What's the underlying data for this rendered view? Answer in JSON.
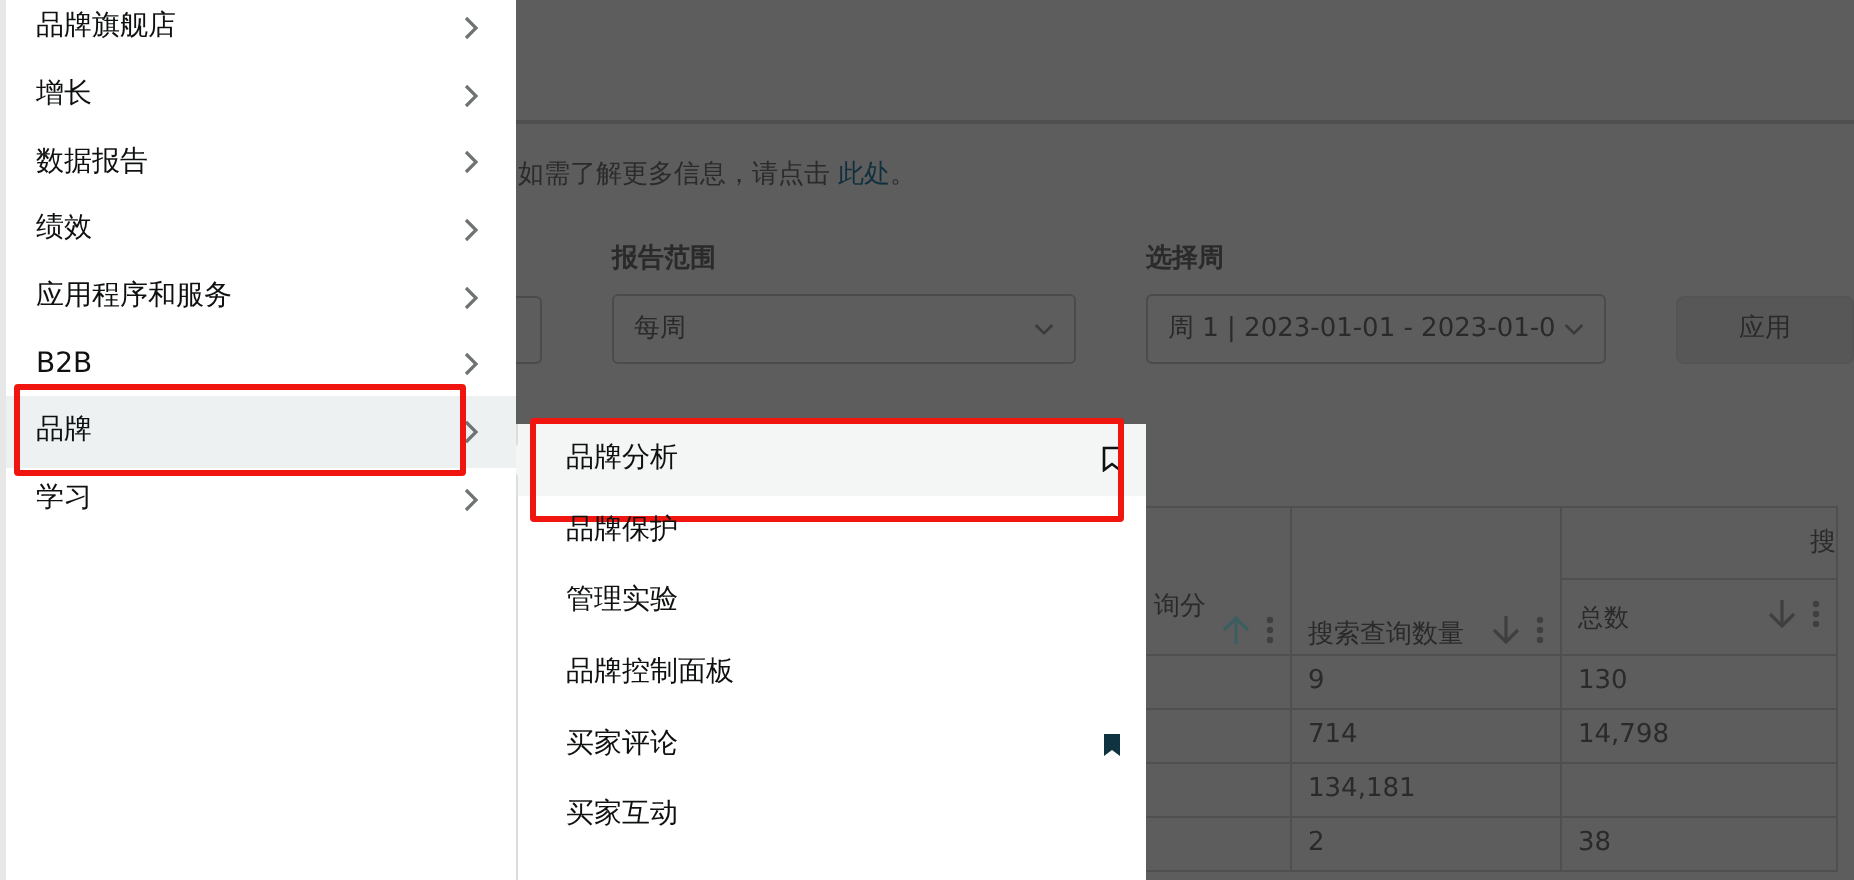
{
  "menu": [
    {
      "label": "品牌旗舰店",
      "selected": false,
      "annotated": false
    },
    {
      "label": "增长",
      "selected": false,
      "annotated": false
    },
    {
      "label": "数据报告",
      "selected": false,
      "annotated": false
    },
    {
      "label": "绩效",
      "selected": false,
      "annotated": false
    },
    {
      "label": "应用程序和服务",
      "selected": false,
      "annotated": false
    },
    {
      "label": "B2B",
      "selected": false,
      "annotated": false
    },
    {
      "label": "品牌",
      "selected": true,
      "annotated": true
    },
    {
      "label": "学习",
      "selected": false,
      "annotated": false
    }
  ],
  "submenu": [
    {
      "label": "品牌分析",
      "selected": true,
      "annotated": true,
      "pinned": false
    },
    {
      "label": "品牌保护",
      "selected": false,
      "annotated": false,
      "pinned": false
    },
    {
      "label": "管理实验",
      "selected": false,
      "annotated": false,
      "pinned": false
    },
    {
      "label": "品牌控制面板",
      "selected": false,
      "annotated": false,
      "pinned": false
    },
    {
      "label": "买家评论",
      "selected": false,
      "annotated": false,
      "pinned": true
    },
    {
      "label": "买家互动",
      "selected": false,
      "annotated": false,
      "pinned": false
    }
  ],
  "info": {
    "text": "如需了解更多信息，请点击",
    "link": "此处",
    "end": "。"
  },
  "filters": [
    {
      "label": "报告范围",
      "value": "每周"
    },
    {
      "label": "选择周",
      "value": "周 1 | 2023-01-01 - 2023-01-0"
    }
  ],
  "apply_button": "应用",
  "table": {
    "group_header": "搜",
    "columns": [
      {
        "label": "询分",
        "sorted": true
      },
      {
        "label": "搜索查询数量",
        "sorted": false
      },
      {
        "label": "总数",
        "sorted": false
      }
    ],
    "rows": [
      [
        "",
        "9",
        "130"
      ],
      [
        "",
        "714",
        "14,798"
      ],
      [
        "",
        "134,181",
        ""
      ],
      [
        "",
        "2",
        "38"
      ]
    ]
  }
}
